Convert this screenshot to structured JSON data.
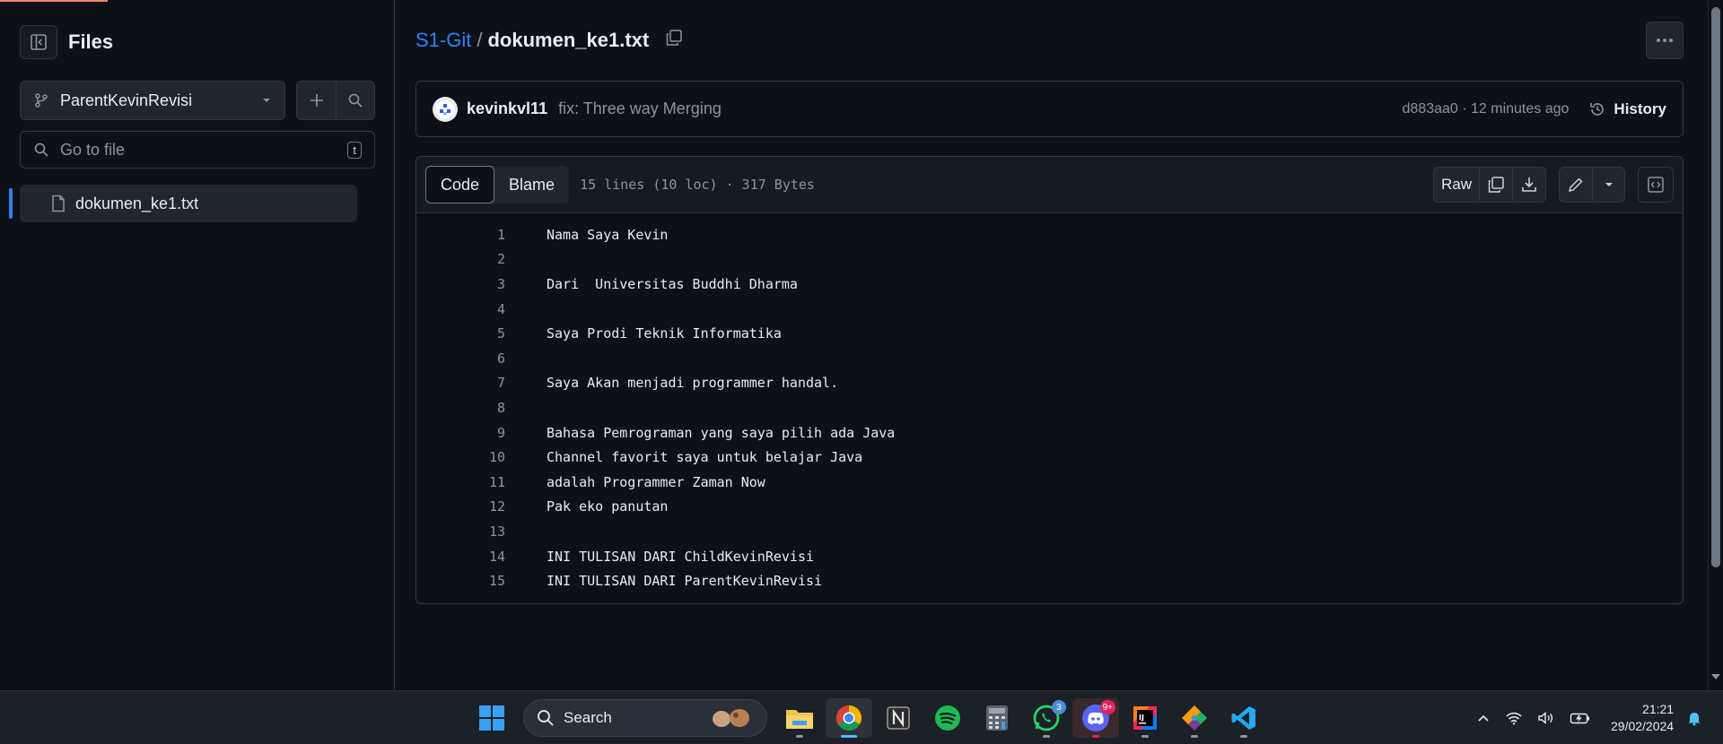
{
  "sidebar": {
    "title": "Files",
    "branch": "ParentKevinRevisi",
    "goto_placeholder": "Go to file",
    "goto_shortcut": "t",
    "files": [
      "dokumen_ke1.txt"
    ]
  },
  "breadcrumb": {
    "repo": "S1-Git",
    "separator": "/",
    "file": "dokumen_ke1.txt"
  },
  "commit": {
    "author": "kevinkvl11",
    "message": "fix: Three way Merging",
    "sha_time": "d883aa0 · 12 minutes ago",
    "history_label": "History"
  },
  "code_view": {
    "tabs": [
      "Code",
      "Blame"
    ],
    "active_tab": "Code",
    "meta": "15 lines (10 loc) · 317 Bytes",
    "raw_label": "Raw",
    "lines": [
      {
        "n": "1",
        "text": "Nama Saya Kevin"
      },
      {
        "n": "2",
        "text": ""
      },
      {
        "n": "3",
        "text": "Dari  Universitas Buddhi Dharma"
      },
      {
        "n": "4",
        "text": ""
      },
      {
        "n": "5",
        "text": "Saya Prodi Teknik Informatika"
      },
      {
        "n": "6",
        "text": ""
      },
      {
        "n": "7",
        "text": "Saya Akan menjadi programmer handal."
      },
      {
        "n": "8",
        "text": ""
      },
      {
        "n": "9",
        "text": "Bahasa Pemrograman yang saya pilih ada Java"
      },
      {
        "n": "10",
        "text": "Channel favorit saya untuk belajar Java"
      },
      {
        "n": "11",
        "text": "adalah Programmer Zaman Now"
      },
      {
        "n": "12",
        "text": "Pak eko panutan"
      },
      {
        "n": "13",
        "text": ""
      },
      {
        "n": "14",
        "text": "INI TULISAN DARI ChildKevinRevisi"
      },
      {
        "n": "15",
        "text": "INI TULISAN DARI ParentKevinRevisi"
      }
    ]
  },
  "taskbar": {
    "search_label": "Search",
    "whatsapp_badge": "3",
    "discord_badge": "9+",
    "time": "21:21",
    "date": "29/02/2024"
  },
  "colors": {
    "background": "#0d1117",
    "link": "#2f81f7",
    "border": "#30363d",
    "muted": "#8b949e"
  }
}
